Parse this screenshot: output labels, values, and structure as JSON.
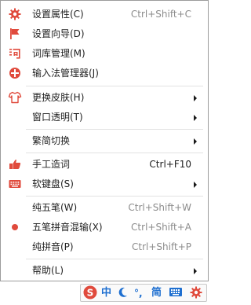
{
  "menu": {
    "items": [
      {
        "label": "设置属性(C)",
        "shortcut": "Ctrl+Shift+C"
      },
      {
        "label": "设置向导(D)"
      },
      {
        "label": "词库管理(M)"
      },
      {
        "label": "输入法管理器(J)"
      },
      {
        "label": "更换皮肤(H)"
      },
      {
        "label": "窗口透明(T)"
      },
      {
        "label": "繁简切换"
      },
      {
        "label": "手工造词",
        "shortcut": "Ctrl+F10"
      },
      {
        "label": "软键盘(S)"
      },
      {
        "label": "纯五笔(W)",
        "shortcut": "Ctrl+Shift+W"
      },
      {
        "label": "五笔拼音混输(X)",
        "shortcut": "Ctrl+Shift+A"
      },
      {
        "label": "纯拼音(P)",
        "shortcut": "Ctrl+Shift+P"
      },
      {
        "label": "帮助(L)"
      }
    ]
  },
  "statusbar": {
    "logo": "S",
    "lang": "中",
    "punct": "°,",
    "script": "简"
  },
  "colors": {
    "icon_red": "#e04a3c",
    "status_blue": "#1e6fd0"
  }
}
